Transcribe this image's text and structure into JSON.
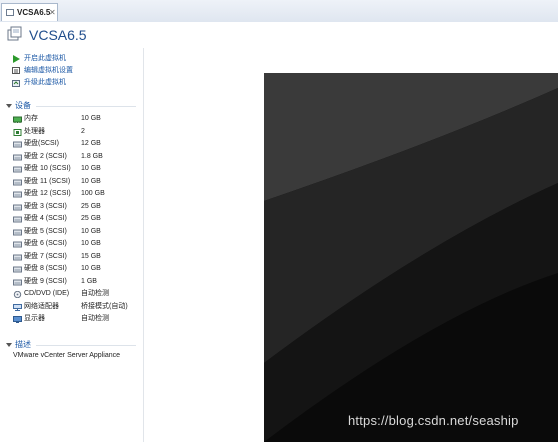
{
  "tab": {
    "label": "VCSA6.5",
    "close": "✕"
  },
  "header": {
    "title": "VCSA6.5"
  },
  "actions": [
    {
      "label": "开启此虚拟机",
      "icon": "play-icon"
    },
    {
      "label": "编辑虚拟机设置",
      "icon": "edit-settings-icon"
    },
    {
      "label": "升级此虚拟机",
      "icon": "upgrade-icon"
    }
  ],
  "devices_section": {
    "label": "设备"
  },
  "devices": [
    {
      "name": "内存",
      "value": "10 GB",
      "icon": "memory-icon"
    },
    {
      "name": "处理器",
      "value": "2",
      "icon": "processor-icon"
    },
    {
      "name": "硬盘(SCSI)",
      "value": "12 GB",
      "icon": "hard-disk-icon"
    },
    {
      "name": "硬盘 2 (SCSI)",
      "value": "1.8 GB",
      "icon": "hard-disk-icon"
    },
    {
      "name": "硬盘 10 (SCSI)",
      "value": "10 GB",
      "icon": "hard-disk-icon"
    },
    {
      "name": "硬盘 11 (SCSI)",
      "value": "10 GB",
      "icon": "hard-disk-icon"
    },
    {
      "name": "硬盘 12 (SCSI)",
      "value": "100 GB",
      "icon": "hard-disk-icon"
    },
    {
      "name": "硬盘 3 (SCSI)",
      "value": "25 GB",
      "icon": "hard-disk-icon"
    },
    {
      "name": "硬盘 4 (SCSI)",
      "value": "25 GB",
      "icon": "hard-disk-icon"
    },
    {
      "name": "硬盘 5 (SCSI)",
      "value": "10 GB",
      "icon": "hard-disk-icon"
    },
    {
      "name": "硬盘 6 (SCSI)",
      "value": "10 GB",
      "icon": "hard-disk-icon"
    },
    {
      "name": "硬盘 7 (SCSI)",
      "value": "15 GB",
      "icon": "hard-disk-icon"
    },
    {
      "name": "硬盘 8 (SCSI)",
      "value": "10 GB",
      "icon": "hard-disk-icon"
    },
    {
      "name": "硬盘 9 (SCSI)",
      "value": "1 GB",
      "icon": "hard-disk-icon"
    },
    {
      "name": "CD/DVD (IDE)",
      "value": "自动检测",
      "icon": "cd-dvd-icon"
    },
    {
      "name": "网络适配器",
      "value": "桥接模式(自动)",
      "icon": "network-adapter-icon"
    },
    {
      "name": "显示器",
      "value": "自动检测",
      "icon": "display-icon"
    }
  ],
  "description_section": {
    "label": "描述"
  },
  "description": "VMware vCenter Server Appliance",
  "watermark": "https://blog.csdn.net/seaship",
  "colors": {
    "link": "#1a57a5",
    "title": "#1f4d8c",
    "console_dark": "#0a0a0a"
  }
}
